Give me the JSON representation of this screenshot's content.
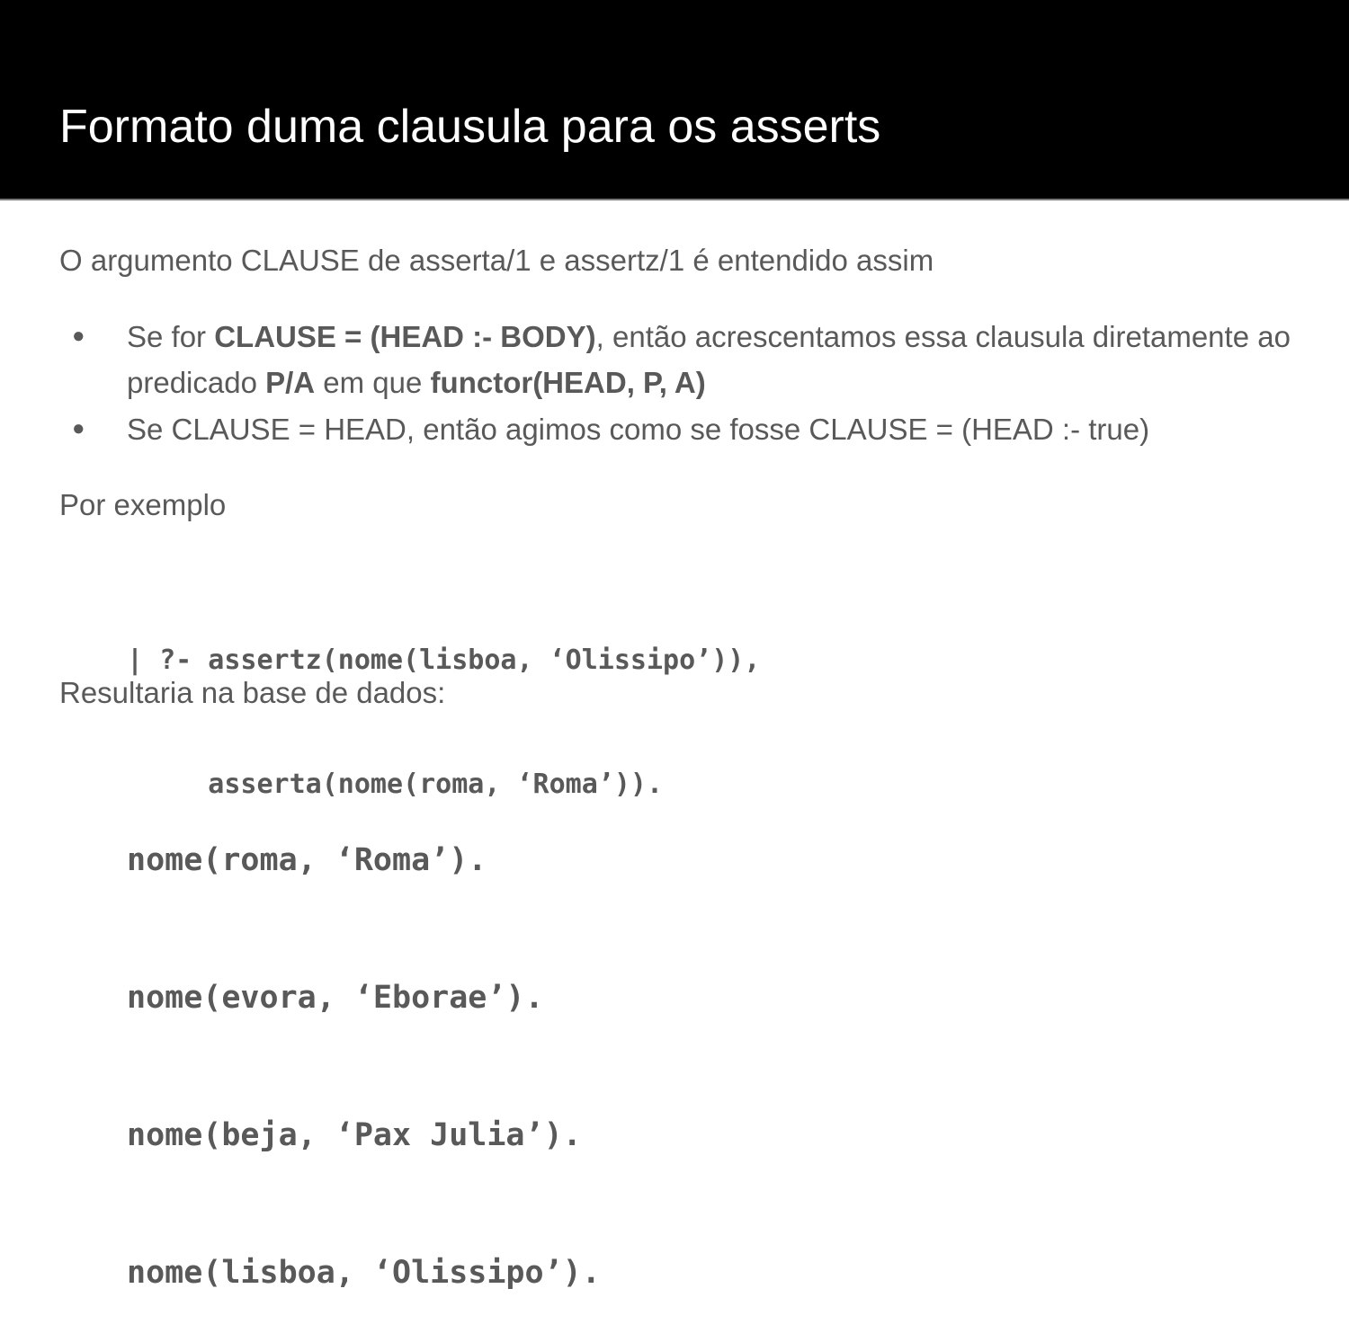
{
  "slide": {
    "title": "Formato duma clausula para os asserts",
    "intro": "O argumento CLAUSE de asserta/1 e assertz/1 é entendido assim",
    "bullets": [
      {
        "dot": "●",
        "parts": [
          "Se for ",
          "CLAUSE = (HEAD :- BODY)",
          ", então acrescentamos essa clausula diretamente ao predicado ",
          "P/A",
          " em que ",
          "functor(HEAD, P, A)"
        ]
      },
      {
        "dot": "●",
        "text": "Se CLAUSE = HEAD, então agimos como se fosse CLAUSE = (HEAD :- true)"
      }
    ],
    "example_label": "Por exemplo",
    "query_lines": [
      "| ?- assertz(nome(lisboa, ‘Olissipo’)),",
      "     asserta(nome(roma, ‘Roma’))."
    ],
    "result_label": "Resultaria na base de dados:",
    "result_lines": [
      "nome(roma, ‘Roma’).",
      "nome(evora, ‘Eborae’).",
      "nome(beja, ‘Pax Julia’).",
      "nome(lisboa, ‘Olissipo’)."
    ]
  }
}
